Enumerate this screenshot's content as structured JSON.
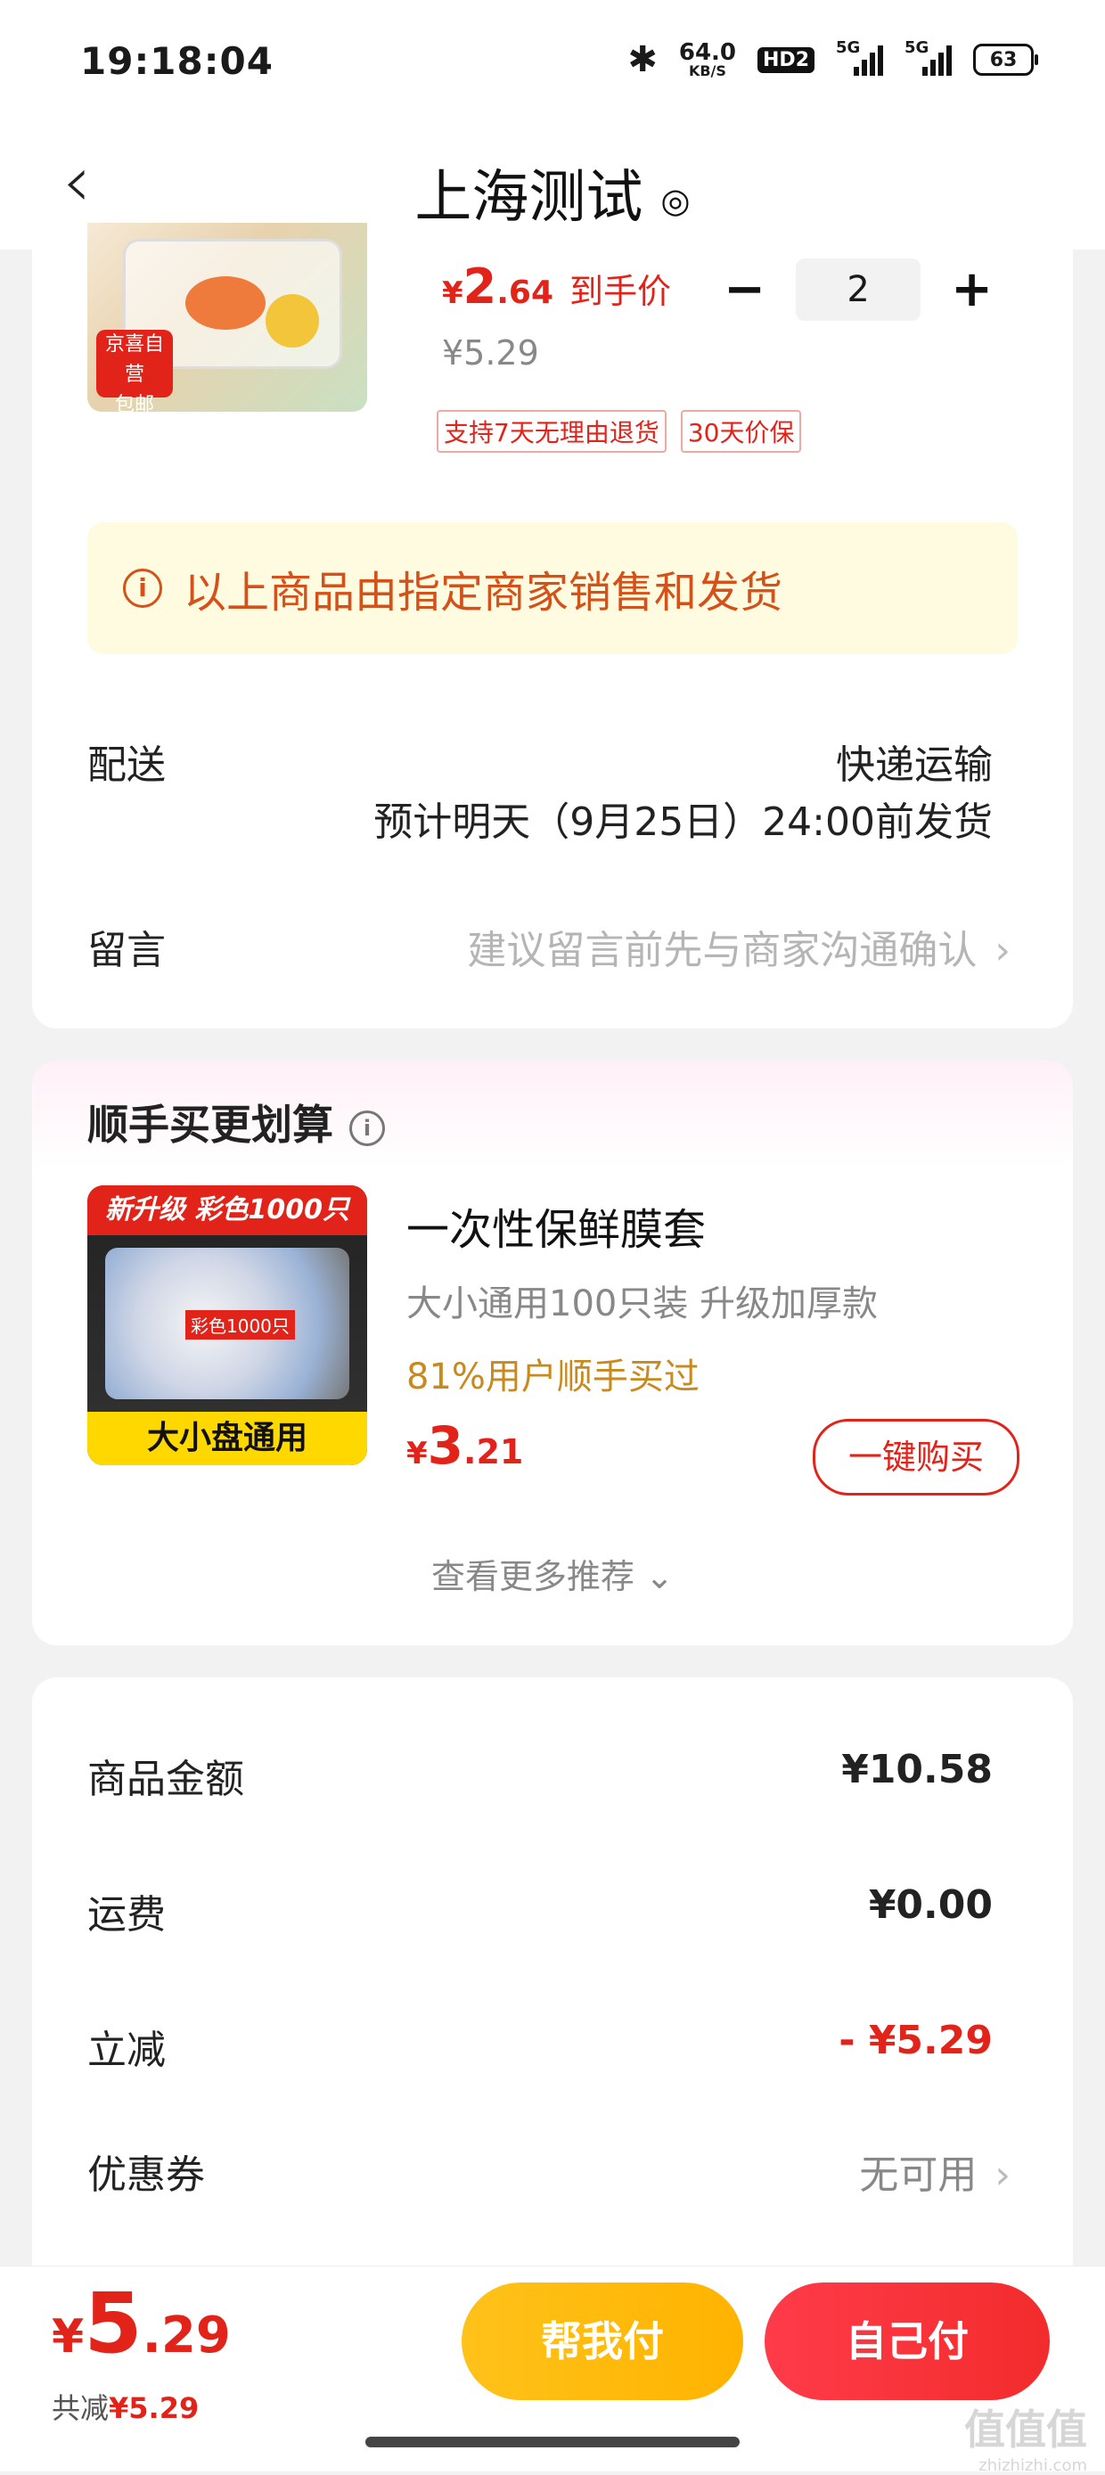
{
  "status_bar": {
    "time": "19:18:04",
    "speed_value": "64.0",
    "speed_unit": "KB/S",
    "hd": "HD2",
    "sig1": "5G",
    "sig2": "5G",
    "battery": "63"
  },
  "header": {
    "title": "上海测试",
    "back_icon": "‹",
    "location_icon": "◎"
  },
  "product": {
    "badge_line1": "京喜自营",
    "badge_line2": "包邮",
    "price_symbol": "¥",
    "price_int": "2",
    "price_dec": ".64",
    "price_label": "到手价",
    "original_price": "¥5.29",
    "quantity": "2",
    "minus": "−",
    "plus": "+",
    "tags": [
      "支持7天无理由退货",
      "30天价保"
    ]
  },
  "notice": {
    "icon": "i",
    "text": "以上商品由指定商家销售和发货"
  },
  "delivery": {
    "label": "配送",
    "method": "快递运输",
    "eta": "预计明天（9月25日）24:00前发货"
  },
  "message": {
    "label": "留言",
    "placeholder": "建议留言前先与商家沟通确认",
    "chevron": "›"
  },
  "recommend": {
    "title": "顺手买更划算",
    "info_icon": "i",
    "image_banner": "新升级 彩色1000只",
    "image_mini_tag": "彩色1000只",
    "image_footer": "大小盘通用",
    "name": "一次性保鲜膜套",
    "spec": "大小通用100只装  升级加厚款",
    "social": "81%用户顺手买过",
    "price_symbol": "¥",
    "price_int": "3",
    "price_dec": ".21",
    "buy_label": "一键购买",
    "more_label": "查看更多推荐 ⌄"
  },
  "summary": {
    "goods_label": "商品金额",
    "goods_value": "¥10.58",
    "shipping_label": "运费",
    "shipping_value": "¥0.00",
    "discount_label": "立减",
    "discount_value": "- ¥5.29",
    "coupon_label": "优惠券",
    "coupon_value": "无可用",
    "chevron": "›"
  },
  "bottom": {
    "total_symbol": "¥",
    "total_int": "5",
    "total_dec": ".29",
    "saved_label": "共减",
    "saved_value": "¥5.29",
    "help_pay": "帮我付",
    "self_pay": "自己付"
  },
  "watermark": {
    "text": "值值值",
    "sub": "zhizhizhi.com"
  },
  "colors": {
    "accent": "#e2231a",
    "notice_bg": "#fffbe0",
    "notice_text": "#d4511a",
    "help_btn": "#ffb300",
    "pay_btn": "#f22c2c"
  }
}
